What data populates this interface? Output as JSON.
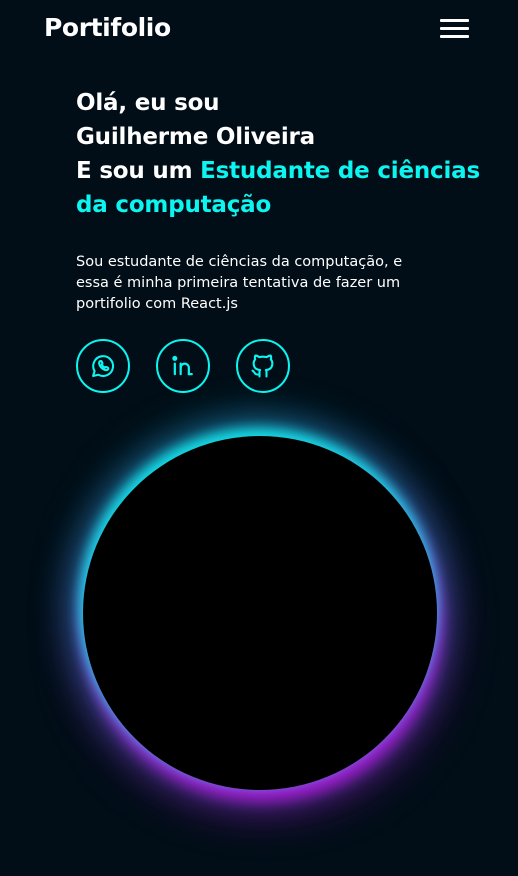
{
  "header": {
    "logo": "Portifolio",
    "menu_icon": "hamburger-menu-icon"
  },
  "hero": {
    "greeting": "Olá, eu sou",
    "name": "Guilherme Oliveira",
    "intro_prefix": "E sou um ",
    "role_line1": "Estudante de ciências",
    "role_line2": "da computação",
    "accent_color": "#0cf5f0"
  },
  "about": {
    "description": "Sou estudante de ciências da computação, e essa é minha primeira tentativa de fazer um portifolio com React.js"
  },
  "socials": [
    {
      "icon": "whatsapp-icon"
    },
    {
      "icon": "linkedin-icon"
    },
    {
      "icon": "github-icon"
    }
  ],
  "colors": {
    "background": "#010e17",
    "accent": "#0cf5f0",
    "glow_secondary": "#aa14d2"
  }
}
